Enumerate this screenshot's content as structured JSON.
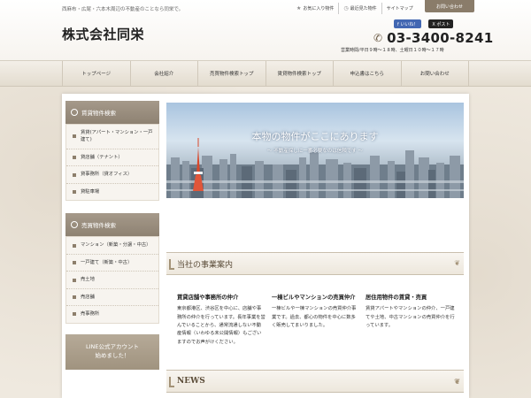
{
  "header": {
    "tagline": "西麻布・広尾・六本木周辺の不動産のことなら同栄で。",
    "logo": "株式会社同栄",
    "favorites": "お気に入り物件",
    "recent": "最近見た物件",
    "sitemap": "サイトマップ",
    "contact_tab": "お問い合わせ",
    "fb_like": "f いいね！",
    "x_post": "X ポスト",
    "phone": "03-3400-8241",
    "hours": "営業時間/平日９時～１８時、土曜日１０時～１７時"
  },
  "nav": [
    "トップページ",
    "会社紹介",
    "売買物件検索トップ",
    "賃貸物件検索トップ",
    "申込書はこちら",
    "お問い合わせ"
  ],
  "sidebar": {
    "rent_title": "賃貸物件検索",
    "rent_items": [
      "賃貸(アパート・マンション・一戸建て)",
      "貸店舗（テナント）",
      "貸事務所（貸オフィス）",
      "貸駐車場"
    ],
    "sale_title": "売買物件検索",
    "sale_items": [
      "マンション（新築・分譲・中古）",
      "一戸建て（新築・中古）",
      "売土地",
      "売店舗",
      "売事務所"
    ],
    "line_line1": "LINE公式アカウント",
    "line_line2": "始めました！"
  },
  "hero": {
    "title": "本物の物件がここにあります",
    "subtitle": "〜 不動産探しに一番必要なのは信頼です 〜"
  },
  "business": {
    "heading": "当社の事業案内",
    "items": [
      {
        "title": "賃貸店舗や事務所の仲介",
        "text": "東京都港区、渋谷区を中心に、店舗や事務所の仲介を行っています。長年事業を営んでいることから、通常流通しない不動産情報（いわゆる未公開情報）もございますのでお声がけください。"
      },
      {
        "title": "一棟ビルやマンションの売買仲介",
        "text": "一棟ビルや一棟マンションの売買仲介事業です。過去、都心の物件を中心に数多く販売してまいりました。"
      },
      {
        "title": "居住用物件の賃貸・売買",
        "text": "賃貸アパートやマンションの仲介、一戸建てや土地、中古マンションの売買仲介を行っています。"
      }
    ]
  },
  "news": {
    "heading": "NEWS"
  },
  "colors": {
    "accent": "#8e8272",
    "nav_bg": "#e9e3d8",
    "fb": "#4267b2"
  }
}
